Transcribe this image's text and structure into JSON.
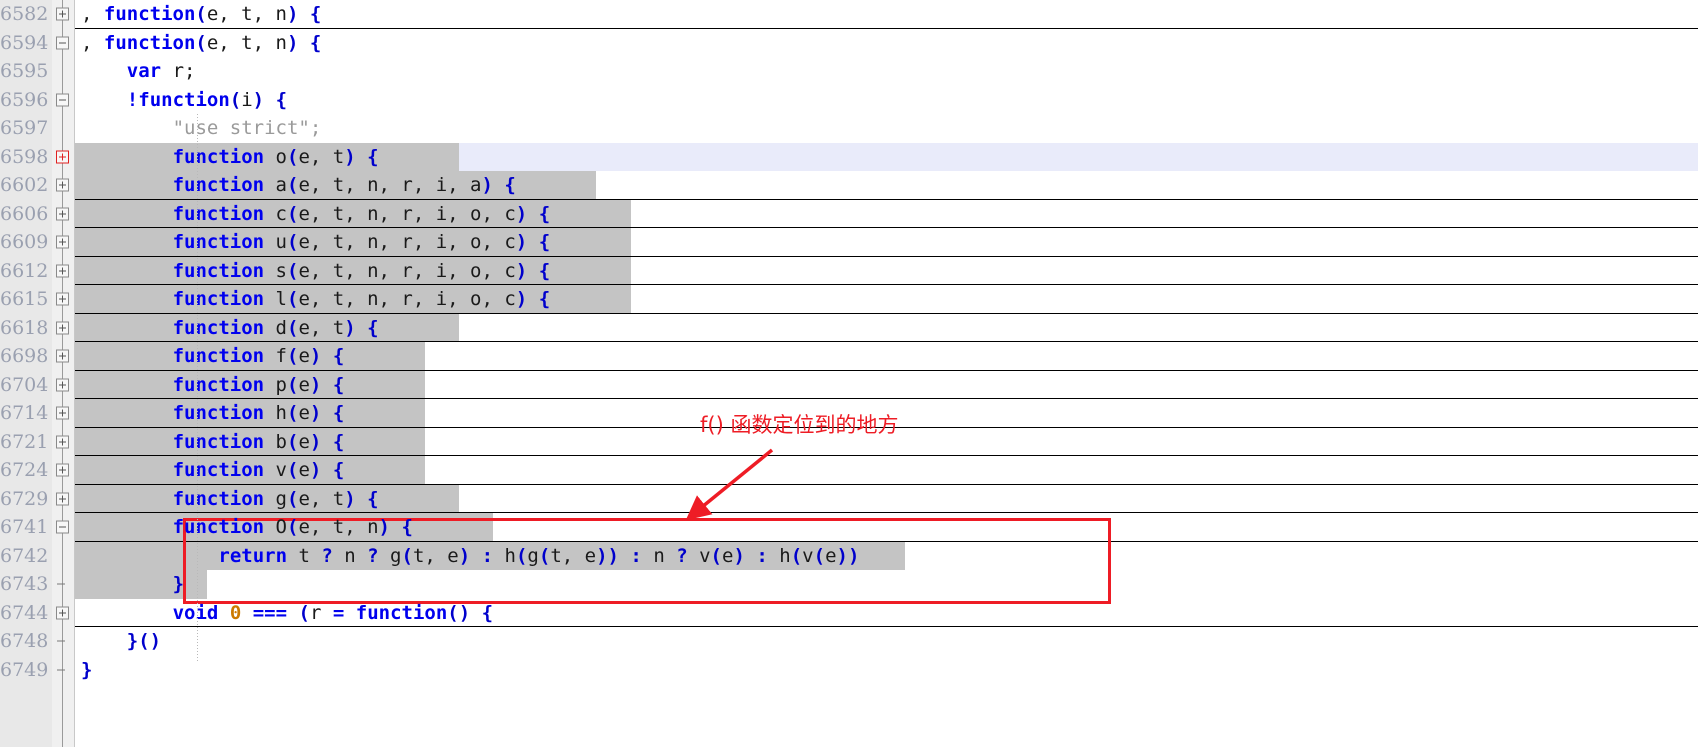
{
  "app": {
    "kind": "code-editor",
    "language": "JavaScript"
  },
  "theme": {
    "background": "#ffffff",
    "gutter_bg": "#e8e8e8",
    "line_number_color": "#9aa0b0",
    "folded_region_bg": "#c4c4c4",
    "current_line_bg": "#e9ebfa",
    "keyword_color": "#0000ee",
    "punctuation_color": "#0000cc",
    "string_color": "#9a9a9a",
    "number_color": "#cc7a00",
    "annotation_color": "#ee1c25"
  },
  "annotation": {
    "text": "f() 函数定位到的地方",
    "arrow_from": "700,470",
    "arrow_to": "690,510",
    "box_label": "highlighted-code-region"
  },
  "lines": [
    {
      "num": "6582",
      "fold": "plus",
      "indent": 0,
      "current": false,
      "folded": false,
      "chip_start": null,
      "chip_end": null,
      "sep": true,
      "tokens": [
        {
          "t": ", ",
          "c": "id"
        },
        {
          "t": "function",
          "c": "kw"
        },
        {
          "t": "(",
          "c": "pn"
        },
        {
          "t": "e, t, n",
          "c": "id"
        },
        {
          "t": ")",
          "c": "pn"
        },
        {
          "t": " ",
          "c": "id"
        },
        {
          "t": "{",
          "c": "pn"
        }
      ]
    },
    {
      "num": "6594",
      "fold": "minus",
      "indent": 0,
      "current": false,
      "folded": false,
      "chip_start": null,
      "chip_end": null,
      "sep": false,
      "tokens": [
        {
          "t": ", ",
          "c": "id"
        },
        {
          "t": "function",
          "c": "kw"
        },
        {
          "t": "(",
          "c": "pn"
        },
        {
          "t": "e, t, n",
          "c": "id"
        },
        {
          "t": ")",
          "c": "pn"
        },
        {
          "t": " ",
          "c": "id"
        },
        {
          "t": "{",
          "c": "pn"
        }
      ]
    },
    {
      "num": "6595",
      "fold": "none",
      "indent": 1,
      "current": false,
      "folded": false,
      "chip_start": null,
      "chip_end": null,
      "sep": false,
      "tokens": [
        {
          "t": "var",
          "c": "kw"
        },
        {
          "t": " r;",
          "c": "id"
        }
      ]
    },
    {
      "num": "6596",
      "fold": "minus",
      "indent": 1,
      "current": false,
      "folded": false,
      "chip_start": null,
      "chip_end": null,
      "sep": false,
      "tokens": [
        {
          "t": "!",
          "c": "kw"
        },
        {
          "t": "function",
          "c": "kw"
        },
        {
          "t": "(",
          "c": "pn"
        },
        {
          "t": "i",
          "c": "id"
        },
        {
          "t": ")",
          "c": "pn"
        },
        {
          "t": " ",
          "c": "id"
        },
        {
          "t": "{",
          "c": "pn"
        }
      ]
    },
    {
      "num": "6597",
      "fold": "none",
      "indent": 2,
      "current": false,
      "folded": false,
      "chip_start": null,
      "chip_end": null,
      "sep": false,
      "tokens": [
        {
          "t": "\"use strict\";",
          "c": "str"
        }
      ]
    },
    {
      "num": "6598",
      "fold": "current",
      "indent": 2,
      "current": true,
      "folded": true,
      "chip_start": 2,
      "chip_end": 25,
      "sep": false,
      "tokens": [
        {
          "t": "function",
          "c": "kw"
        },
        {
          "t": " o",
          "c": "id"
        },
        {
          "t": "(",
          "c": "pn"
        },
        {
          "t": "e, t",
          "c": "id"
        },
        {
          "t": ")",
          "c": "pn"
        },
        {
          "t": " ",
          "c": "id"
        },
        {
          "t": "{",
          "c": "pn"
        }
      ]
    },
    {
      "num": "6602",
      "fold": "plus",
      "indent": 2,
      "current": false,
      "folded": true,
      "chip_start": 0,
      "chip_end": 37,
      "sep": true,
      "tokens": [
        {
          "t": "function",
          "c": "kw"
        },
        {
          "t": " a",
          "c": "id"
        },
        {
          "t": "(",
          "c": "pn"
        },
        {
          "t": "e, t, n, r, i, a",
          "c": "id"
        },
        {
          "t": ")",
          "c": "pn"
        },
        {
          "t": " ",
          "c": "id"
        },
        {
          "t": "{",
          "c": "pn"
        }
      ]
    },
    {
      "num": "6606",
      "fold": "plus",
      "indent": 2,
      "current": false,
      "folded": true,
      "chip_start": 0,
      "chip_end": 40,
      "sep": true,
      "tokens": [
        {
          "t": "function",
          "c": "kw"
        },
        {
          "t": " c",
          "c": "id"
        },
        {
          "t": "(",
          "c": "pn"
        },
        {
          "t": "e, t, n, r, i, o, c",
          "c": "id"
        },
        {
          "t": ")",
          "c": "pn"
        },
        {
          "t": " ",
          "c": "id"
        },
        {
          "t": "{",
          "c": "pn"
        }
      ]
    },
    {
      "num": "6609",
      "fold": "plus",
      "indent": 2,
      "current": false,
      "folded": true,
      "chip_start": 0,
      "chip_end": 40,
      "sep": true,
      "tokens": [
        {
          "t": "function",
          "c": "kw"
        },
        {
          "t": " u",
          "c": "id"
        },
        {
          "t": "(",
          "c": "pn"
        },
        {
          "t": "e, t, n, r, i, o, c",
          "c": "id"
        },
        {
          "t": ")",
          "c": "pn"
        },
        {
          "t": " ",
          "c": "id"
        },
        {
          "t": "{",
          "c": "pn"
        }
      ]
    },
    {
      "num": "6612",
      "fold": "plus",
      "indent": 2,
      "current": false,
      "folded": true,
      "chip_start": 0,
      "chip_end": 40,
      "sep": true,
      "tokens": [
        {
          "t": "function",
          "c": "kw"
        },
        {
          "t": " s",
          "c": "id"
        },
        {
          "t": "(",
          "c": "pn"
        },
        {
          "t": "e, t, n, r, i, o, c",
          "c": "id"
        },
        {
          "t": ")",
          "c": "pn"
        },
        {
          "t": " ",
          "c": "id"
        },
        {
          "t": "{",
          "c": "pn"
        }
      ]
    },
    {
      "num": "6615",
      "fold": "plus",
      "indent": 2,
      "current": false,
      "folded": true,
      "chip_start": 0,
      "chip_end": 40,
      "sep": true,
      "tokens": [
        {
          "t": "function",
          "c": "kw"
        },
        {
          "t": " l",
          "c": "id"
        },
        {
          "t": "(",
          "c": "pn"
        },
        {
          "t": "e, t, n, r, i, o, c",
          "c": "id"
        },
        {
          "t": ")",
          "c": "pn"
        },
        {
          "t": " ",
          "c": "id"
        },
        {
          "t": "{",
          "c": "pn"
        }
      ]
    },
    {
      "num": "6618",
      "fold": "plus",
      "indent": 2,
      "current": false,
      "folded": true,
      "chip_start": 0,
      "chip_end": 25,
      "sep": true,
      "tokens": [
        {
          "t": "function",
          "c": "kw"
        },
        {
          "t": " d",
          "c": "id"
        },
        {
          "t": "(",
          "c": "pn"
        },
        {
          "t": "e, t",
          "c": "id"
        },
        {
          "t": ")",
          "c": "pn"
        },
        {
          "t": " ",
          "c": "id"
        },
        {
          "t": "{",
          "c": "pn"
        }
      ]
    },
    {
      "num": "6698",
      "fold": "plus",
      "indent": 2,
      "current": false,
      "folded": true,
      "chip_start": 0,
      "chip_end": 22,
      "sep": true,
      "tokens": [
        {
          "t": "function",
          "c": "kw"
        },
        {
          "t": " f",
          "c": "id"
        },
        {
          "t": "(",
          "c": "pn"
        },
        {
          "t": "e",
          "c": "id"
        },
        {
          "t": ")",
          "c": "pn"
        },
        {
          "t": " ",
          "c": "id"
        },
        {
          "t": "{",
          "c": "pn"
        }
      ]
    },
    {
      "num": "6704",
      "fold": "plus",
      "indent": 2,
      "current": false,
      "folded": true,
      "chip_start": 0,
      "chip_end": 22,
      "sep": true,
      "tokens": [
        {
          "t": "function",
          "c": "kw"
        },
        {
          "t": " p",
          "c": "id"
        },
        {
          "t": "(",
          "c": "pn"
        },
        {
          "t": "e",
          "c": "id"
        },
        {
          "t": ")",
          "c": "pn"
        },
        {
          "t": " ",
          "c": "id"
        },
        {
          "t": "{",
          "c": "pn"
        }
      ]
    },
    {
      "num": "6714",
      "fold": "plus",
      "indent": 2,
      "current": false,
      "folded": true,
      "chip_start": 0,
      "chip_end": 22,
      "sep": true,
      "tokens": [
        {
          "t": "function",
          "c": "kw"
        },
        {
          "t": " h",
          "c": "id"
        },
        {
          "t": "(",
          "c": "pn"
        },
        {
          "t": "e",
          "c": "id"
        },
        {
          "t": ")",
          "c": "pn"
        },
        {
          "t": " ",
          "c": "id"
        },
        {
          "t": "{",
          "c": "pn"
        }
      ]
    },
    {
      "num": "6721",
      "fold": "plus",
      "indent": 2,
      "current": false,
      "folded": true,
      "chip_start": 0,
      "chip_end": 22,
      "sep": true,
      "tokens": [
        {
          "t": "function",
          "c": "kw"
        },
        {
          "t": " b",
          "c": "id"
        },
        {
          "t": "(",
          "c": "pn"
        },
        {
          "t": "e",
          "c": "id"
        },
        {
          "t": ")",
          "c": "pn"
        },
        {
          "t": " ",
          "c": "id"
        },
        {
          "t": "{",
          "c": "pn"
        }
      ]
    },
    {
      "num": "6724",
      "fold": "plus",
      "indent": 2,
      "current": false,
      "folded": true,
      "chip_start": 0,
      "chip_end": 22,
      "sep": true,
      "tokens": [
        {
          "t": "function",
          "c": "kw"
        },
        {
          "t": " v",
          "c": "id"
        },
        {
          "t": "(",
          "c": "pn"
        },
        {
          "t": "e",
          "c": "id"
        },
        {
          "t": ")",
          "c": "pn"
        },
        {
          "t": " ",
          "c": "id"
        },
        {
          "t": "{",
          "c": "pn"
        }
      ]
    },
    {
      "num": "6729",
      "fold": "plus",
      "indent": 2,
      "current": false,
      "folded": true,
      "chip_start": 0,
      "chip_end": 25,
      "sep": true,
      "tokens": [
        {
          "t": "function",
          "c": "kw"
        },
        {
          "t": " g",
          "c": "id"
        },
        {
          "t": "(",
          "c": "pn"
        },
        {
          "t": "e, t",
          "c": "id"
        },
        {
          "t": ")",
          "c": "pn"
        },
        {
          "t": " ",
          "c": "id"
        },
        {
          "t": "{",
          "c": "pn"
        }
      ]
    },
    {
      "num": "6741",
      "fold": "minus",
      "indent": 2,
      "current": false,
      "folded": true,
      "chip_start": 0,
      "chip_end": 28,
      "sep": true,
      "tokens": [
        {
          "t": "function",
          "c": "kw"
        },
        {
          "t": " O",
          "c": "id"
        },
        {
          "t": "(",
          "c": "pn"
        },
        {
          "t": "e, t, n",
          "c": "id"
        },
        {
          "t": ")",
          "c": "pn"
        },
        {
          "t": " ",
          "c": "id"
        },
        {
          "t": "{",
          "c": "pn"
        }
      ]
    },
    {
      "num": "6742",
      "fold": "none",
      "indent": 3,
      "current": false,
      "folded": true,
      "chip_start": 0,
      "chip_end": 60,
      "sep": false,
      "tokens": [
        {
          "t": "return",
          "c": "kw"
        },
        {
          "t": " t ",
          "c": "id"
        },
        {
          "t": "?",
          "c": "pn"
        },
        {
          "t": " n ",
          "c": "id"
        },
        {
          "t": "?",
          "c": "pn"
        },
        {
          "t": " g",
          "c": "id"
        },
        {
          "t": "(",
          "c": "pn"
        },
        {
          "t": "t, e",
          "c": "id"
        },
        {
          "t": ")",
          "c": "pn"
        },
        {
          "t": " ",
          "c": "id"
        },
        {
          "t": ":",
          "c": "pn"
        },
        {
          "t": " h",
          "c": "id"
        },
        {
          "t": "(",
          "c": "pn"
        },
        {
          "t": "g",
          "c": "id"
        },
        {
          "t": "(",
          "c": "pn"
        },
        {
          "t": "t, e",
          "c": "id"
        },
        {
          "t": "))",
          "c": "pn"
        },
        {
          "t": " ",
          "c": "id"
        },
        {
          "t": ":",
          "c": "pn"
        },
        {
          "t": " n ",
          "c": "id"
        },
        {
          "t": "?",
          "c": "pn"
        },
        {
          "t": " v",
          "c": "id"
        },
        {
          "t": "(",
          "c": "pn"
        },
        {
          "t": "e",
          "c": "id"
        },
        {
          "t": ")",
          "c": "pn"
        },
        {
          "t": " ",
          "c": "id"
        },
        {
          "t": ":",
          "c": "pn"
        },
        {
          "t": " h",
          "c": "id"
        },
        {
          "t": "(",
          "c": "pn"
        },
        {
          "t": "v",
          "c": "id"
        },
        {
          "t": "(",
          "c": "pn"
        },
        {
          "t": "e",
          "c": "id"
        },
        {
          "t": "))",
          "c": "pn"
        }
      ]
    },
    {
      "num": "6743",
      "fold": "tick",
      "indent": 2,
      "current": false,
      "folded": true,
      "chip_start": 0,
      "chip_end": 3,
      "sep": false,
      "tokens": [
        {
          "t": "}",
          "c": "pn"
        }
      ]
    },
    {
      "num": "6744",
      "fold": "plus",
      "indent": 2,
      "current": false,
      "folded": false,
      "chip_start": null,
      "chip_end": null,
      "sep": true,
      "tokens": [
        {
          "t": "void",
          "c": "kw"
        },
        {
          "t": " ",
          "c": "id"
        },
        {
          "t": "0",
          "c": "num"
        },
        {
          "t": " ",
          "c": "id"
        },
        {
          "t": "===",
          "c": "kw"
        },
        {
          "t": " ",
          "c": "id"
        },
        {
          "t": "(",
          "c": "pn"
        },
        {
          "t": "r ",
          "c": "id"
        },
        {
          "t": "=",
          "c": "kw"
        },
        {
          "t": " ",
          "c": "id"
        },
        {
          "t": "function",
          "c": "kw"
        },
        {
          "t": "()",
          "c": "pn"
        },
        {
          "t": " ",
          "c": "id"
        },
        {
          "t": "{",
          "c": "pn"
        }
      ]
    },
    {
      "num": "6748",
      "fold": "tick",
      "indent": 1,
      "current": false,
      "folded": false,
      "chip_start": null,
      "chip_end": null,
      "sep": false,
      "tokens": [
        {
          "t": "}()",
          "c": "pn"
        }
      ]
    },
    {
      "num": "6749",
      "fold": "tick",
      "indent": 0,
      "current": false,
      "folded": false,
      "chip_start": null,
      "chip_end": null,
      "sep": false,
      "tokens": [
        {
          "t": "}",
          "c": "pn"
        }
      ]
    }
  ]
}
